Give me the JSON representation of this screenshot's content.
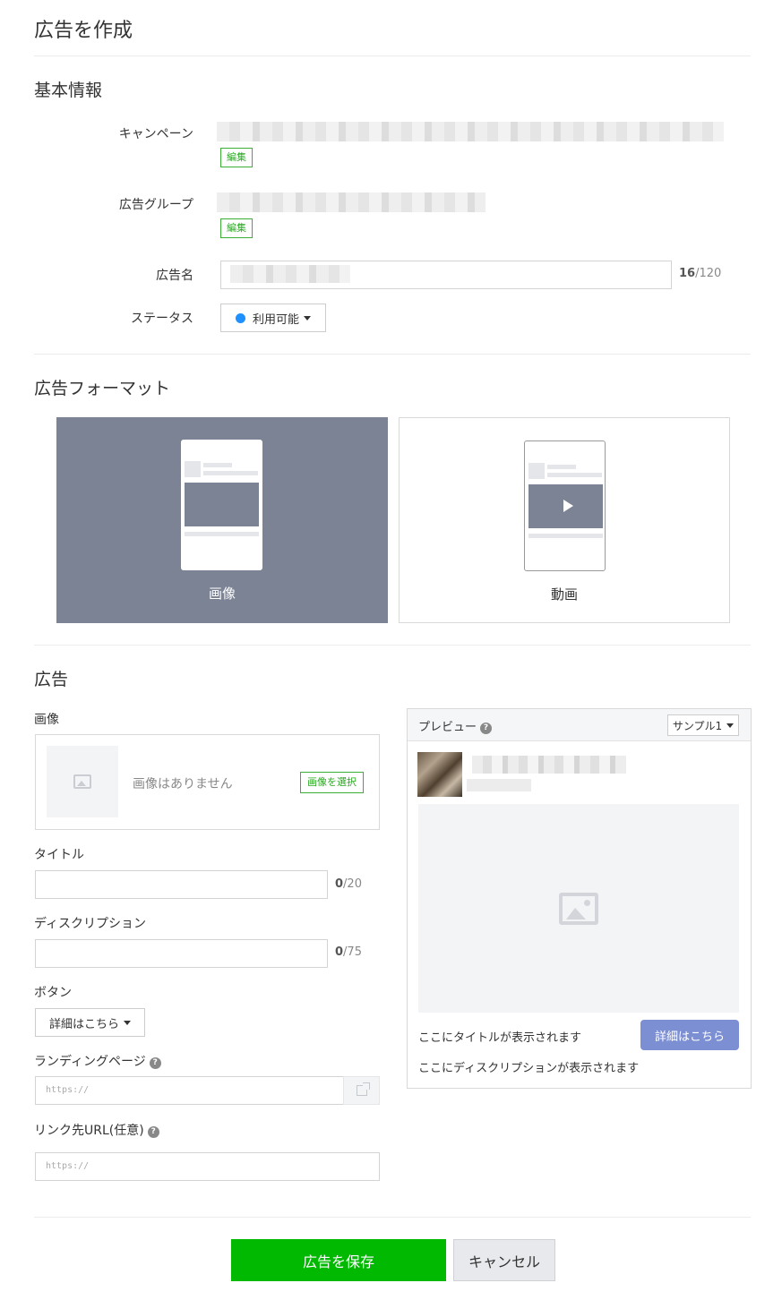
{
  "page": {
    "title": "広告を作成"
  },
  "basic_info": {
    "section_title": "基本情報",
    "campaign_label": "キャンペーン",
    "campaign_edit": "編集",
    "ad_group_label": "広告グループ",
    "ad_group_edit": "編集",
    "ad_name_label": "広告名",
    "ad_name_count": "16",
    "ad_name_max": "/120",
    "status_label": "ステータス",
    "status_value": "利用可能",
    "status_color": "#1e90ff"
  },
  "ad_format": {
    "section_title": "広告フォーマット",
    "options": [
      {
        "label": "画像",
        "selected": true
      },
      {
        "label": "動画",
        "selected": false
      }
    ]
  },
  "ad": {
    "section_title": "広告",
    "image_label": "画像",
    "no_image_text": "画像はありません",
    "select_image_button": "画像を選択",
    "title_label": "タイトル",
    "title_count": "0",
    "title_max": "/20",
    "description_label": "ディスクリプション",
    "description_count": "0",
    "description_max": "/75",
    "button_label": "ボタン",
    "button_value": "詳細はこちら",
    "landing_page_label": "ランディングページ",
    "landing_page_placeholder": "https://",
    "link_url_label": "リンク先URL(任意)",
    "link_url_placeholder": "https://"
  },
  "preview": {
    "title": "プレビュー",
    "sample_value": "サンプル1",
    "title_placeholder": "ここにタイトルが表示されます",
    "description_placeholder": "ここにディスクリプションが表示されます",
    "cta_label": "詳細はこちら",
    "cta_color": "#7d8fd3"
  },
  "footer": {
    "save_label": "広告を保存",
    "cancel_label": "キャンセル",
    "save_color": "#00b900"
  }
}
